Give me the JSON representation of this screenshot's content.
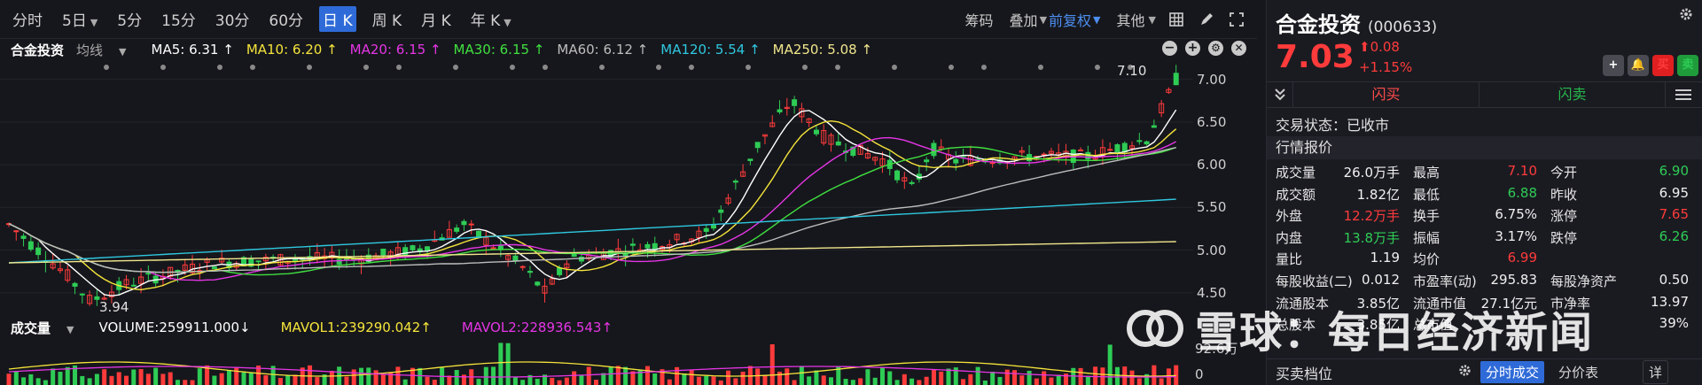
{
  "toolbar": {
    "periods": [
      "分时",
      "5日",
      "5分",
      "15分",
      "30分",
      "60分",
      "日 K",
      "周 K",
      "月 K",
      "年 K"
    ],
    "right_items": {
      "chip": "筹码",
      "overlay": "叠加",
      "adjust": "前复权",
      "other": "其他"
    }
  },
  "ma_legend": {
    "stock_name": "合金投资",
    "mode": "均线",
    "ma5": "MA5: 6.31 ↑",
    "ma10": "MA10: 6.20 ↑",
    "ma20": "MA20: 6.15 ↑",
    "ma30": "MA30: 6.15 ↑",
    "ma60": "MA60: 6.12 ↑",
    "ma120": "MA120: 5.54 ↑",
    "ma250": "MA250: 5.08 ↑",
    "colors": {
      "ma5": "#ffffff",
      "ma10": "#f5e43b",
      "ma20": "#e535e5",
      "ma30": "#40e040",
      "ma60": "#bdbdbd",
      "ma120": "#2fc8e0",
      "ma250": "#f0e68c"
    }
  },
  "price_axis": {
    "ticks": [
      "7.00",
      "6.50",
      "6.00",
      "5.50",
      "5.00",
      "4.50"
    ],
    "values": [
      7.0,
      6.5,
      6.0,
      5.5,
      5.0,
      4.5
    ]
  },
  "kline_annotations": {
    "high": "7.10",
    "low": "3.94"
  },
  "volume_legend": {
    "title": "成交量",
    "volume": "VOLUME:259911.000↓",
    "mavol1": "MAVOL1:239290.042↑",
    "mavol2": "MAVOL2:228936.543↑",
    "axis_top": "92.6万",
    "axis_zero": "0"
  },
  "quote": {
    "name": "合金投资",
    "code": "(000633)",
    "price": "7.03",
    "change": "0.08",
    "change_pct": "+1.15%",
    "buttons": {
      "add": "+",
      "alert": "🔔",
      "buy": "买",
      "sell": "卖"
    },
    "flash_buy": "闪买",
    "flash_sell": "闪卖",
    "trade_status": "交易状态：已收市",
    "section_title": "行情报价",
    "rows": [
      [
        {
          "l": "成交量",
          "v": "26.0万手",
          "c": "white"
        },
        {
          "l": "最高",
          "v": "7.10",
          "c": "red"
        },
        {
          "l": "今开",
          "v": "6.90",
          "c": "green"
        }
      ],
      [
        {
          "l": "成交额",
          "v": "1.82亿",
          "c": "white"
        },
        {
          "l": "最低",
          "v": "6.88",
          "c": "green"
        },
        {
          "l": "昨收",
          "v": "6.95",
          "c": "white"
        }
      ],
      [
        {
          "l": "外盘",
          "v": "12.2万手",
          "c": "red"
        },
        {
          "l": "换手",
          "v": "6.75%",
          "c": "white"
        },
        {
          "l": "涨停",
          "v": "7.65",
          "c": "red"
        }
      ],
      [
        {
          "l": "内盘",
          "v": "13.8万手",
          "c": "green"
        },
        {
          "l": "振幅",
          "v": "3.17%",
          "c": "white"
        },
        {
          "l": "跌停",
          "v": "6.26",
          "c": "green"
        }
      ],
      [
        {
          "l": "量比",
          "v": "1.19",
          "c": "white"
        },
        {
          "l": "均价",
          "v": "6.99",
          "c": "red"
        },
        {
          "l": "",
          "v": "",
          "c": "white"
        }
      ],
      [
        {
          "l": "每股收益(二)",
          "v": "0.012",
          "c": "white"
        },
        {
          "l": "市盈率(动)",
          "v": "295.83",
          "c": "white"
        },
        {
          "l": "每股净资产",
          "v": "0.50",
          "c": "white"
        }
      ],
      [
        {
          "l": "流通股本",
          "v": "3.85亿",
          "c": "white"
        },
        {
          "l": "流通市值",
          "v": "27.1亿元",
          "c": "white"
        },
        {
          "l": "市净率",
          "v": "13.97",
          "c": "white"
        }
      ],
      [
        {
          "l": "总股本",
          "v": "3.85亿",
          "c": "white"
        },
        {
          "l": "总市值",
          "v": "",
          "c": "white"
        },
        {
          "l": "",
          "v": "39%",
          "c": "white"
        }
      ]
    ],
    "orderbook_title": "买卖档位",
    "tab_ticks": "分时成交",
    "tab_price": "分价表",
    "tab_detail": "详"
  },
  "watermark": "雪球：每日经济新闻"
}
